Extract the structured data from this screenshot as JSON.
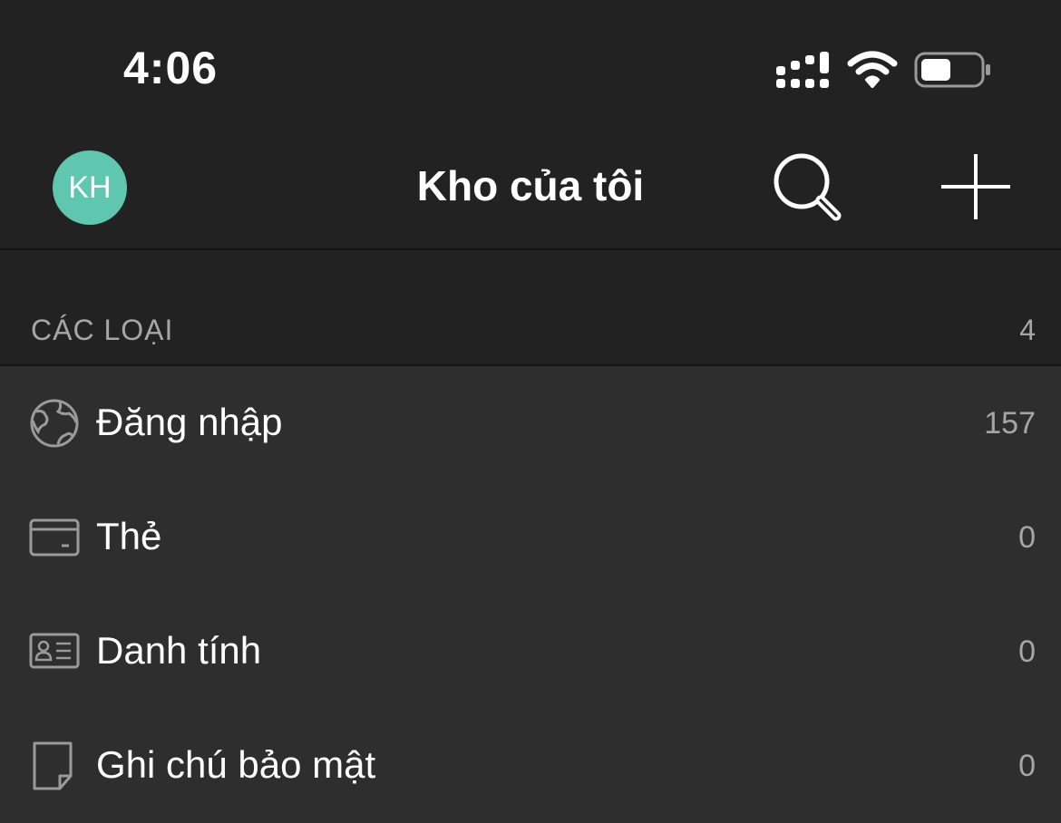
{
  "status_bar": {
    "time": "4:06"
  },
  "nav": {
    "avatar_initials": "KH",
    "title": "Kho của tôi",
    "avatar_color": "#5fc7b0"
  },
  "section": {
    "title": "CÁC LOẠI",
    "count": "4"
  },
  "items": [
    {
      "label": "Đăng nhập",
      "count": "157",
      "icon": "globe-icon"
    },
    {
      "label": "Thẻ",
      "count": "0",
      "icon": "card-icon"
    },
    {
      "label": "Danh tính",
      "count": "0",
      "icon": "id-card-icon"
    },
    {
      "label": "Ghi chú bảo mật",
      "count": "0",
      "icon": "note-icon"
    }
  ]
}
